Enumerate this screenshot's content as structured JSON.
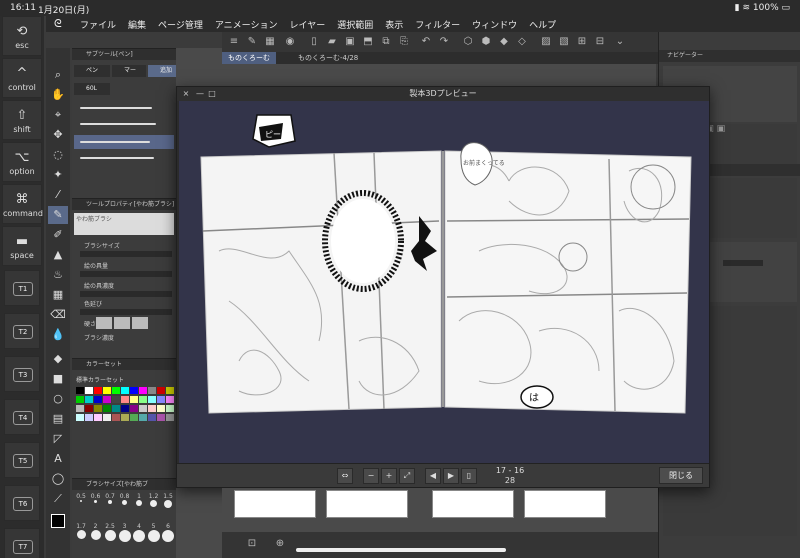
{
  "status": {
    "time": "16:11",
    "date": "1月20日(月)",
    "battery": "100%"
  },
  "menu": {
    "items": [
      "ファイル",
      "編集",
      "ページ管理",
      "アニメーション",
      "レイヤー",
      "選択範囲",
      "表示",
      "フィルター",
      "ウィンドウ",
      "ヘルプ"
    ]
  },
  "keys": {
    "esc": "esc",
    "control": "control",
    "shift": "shift",
    "option": "option",
    "command": "command",
    "space": "space",
    "t1": "T1",
    "t2": "T2",
    "t3": "T3",
    "t4": "T4",
    "t5": "T5",
    "t6": "T6",
    "t7": "T7"
  },
  "subtool": {
    "header": "サブツール[ペン]",
    "tab_pen": "ペン",
    "tab_marker": "マー",
    "tab_add": "追加",
    "tab_70": "70L",
    "tab_60": "60L"
  },
  "toolprop": {
    "header": "ツールプロパティ[やわ筋ブラシ]",
    "brush_name": "やわ筋ブラシ",
    "brush_size": "ブラシサイズ",
    "paint_amount": "絵の具量",
    "paint_density": "絵の具濃度",
    "color_stretch": "色延び",
    "hardness": "硬さ",
    "brush_density": "ブラシ濃度"
  },
  "colorset": {
    "header": "カラーセット",
    "name": "標準カラーセット"
  },
  "brushsize": {
    "header": "ブラシサイズ[やわ筋ブ",
    "values": [
      "0.5",
      "0.6",
      "0.7",
      "0.8",
      "1",
      "1.2",
      "1.5",
      "1.7",
      "2",
      "2.5",
      "3",
      "4",
      "5",
      "6"
    ]
  },
  "doctabs": {
    "tab1": "ものくろーむ",
    "tab2": "ものくろーむ-4/28"
  },
  "right": {
    "navigator": "ナビゲーター",
    "layer_prop": "ープロパティ"
  },
  "preview": {
    "title": "製本3Dプレビュー",
    "page_range": "17 - 16",
    "page_total": "28",
    "close": "閉じる",
    "bubble1": "ピー",
    "bubble2": "お前まくってる",
    "bubble3": "は"
  }
}
